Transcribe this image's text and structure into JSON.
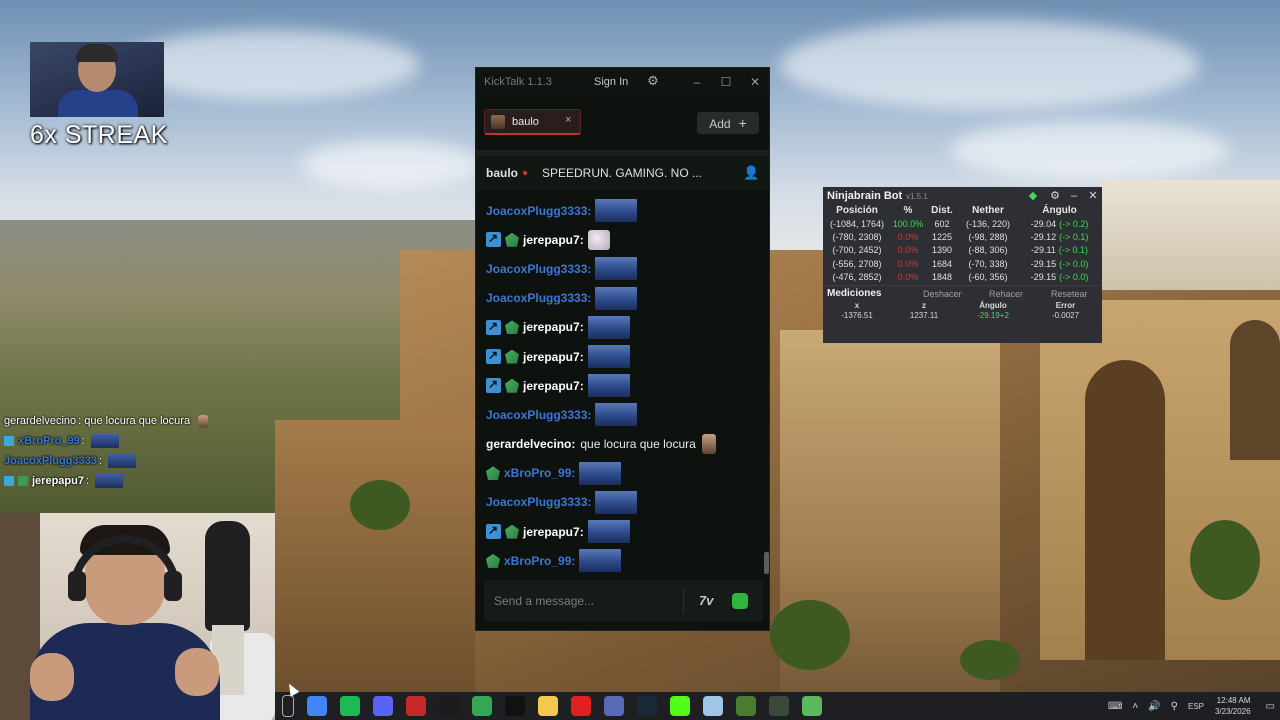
{
  "overlay": {
    "streak_text": "6x STREAK",
    "chat": [
      {
        "user": "gerardelvecino",
        "text": ": que locura que locura",
        "color": "#ffffff",
        "emote": "face"
      },
      {
        "user": "xBroPro_99",
        "text": ":",
        "color": "#3a77d6",
        "emote": "emote"
      },
      {
        "user": "JoacoxPlugg3333",
        "text": ":",
        "color": "#3a77d6",
        "emote": "emote"
      },
      {
        "user": "jerepapu7",
        "text": ":",
        "color": "#ffffff",
        "emote": "emote"
      }
    ]
  },
  "kicktalk": {
    "app_title": "KickTalk 1.1.3",
    "sign_in": "Sign In",
    "icons": {
      "settings": "gear-icon",
      "minimize": "minimize-icon",
      "maximize": "maximize-icon",
      "close": "close-icon"
    },
    "tab": {
      "label": "baulo",
      "close": "×"
    },
    "add_label": "Add",
    "add_plus": "+",
    "channel": {
      "name": "baulo",
      "title": "SPEEDRUN. GAMING. NO ..."
    },
    "username_colors": {
      "blue": "#3a77d6",
      "white": "#ffffff"
    },
    "messages": [
      {
        "user": "JoacoxPlugg3333",
        "sep": ":",
        "color": "#3a77d6",
        "badges": [],
        "emote": "emote"
      },
      {
        "user": "jerepapu7",
        "sep": ":",
        "color": "#ffffff",
        "badges": [
          "mod",
          "sub"
        ],
        "emote": "small"
      },
      {
        "user": "JoacoxPlugg3333",
        "sep": ":",
        "color": "#3a77d6",
        "badges": [],
        "emote": "emote"
      },
      {
        "user": "JoacoxPlugg3333",
        "sep": ":",
        "color": "#3a77d6",
        "badges": [],
        "emote": "emote"
      },
      {
        "user": "jerepapu7",
        "sep": ":",
        "color": "#ffffff",
        "badges": [
          "mod",
          "sub"
        ],
        "emote": "emote"
      },
      {
        "user": "jerepapu7",
        "sep": ":",
        "color": "#ffffff",
        "badges": [
          "mod",
          "sub"
        ],
        "emote": "emote"
      },
      {
        "user": "jerepapu7",
        "sep": ":",
        "color": "#ffffff",
        "badges": [
          "mod",
          "sub"
        ],
        "emote": "emote"
      },
      {
        "user": "JoacoxPlugg3333",
        "sep": ":",
        "color": "#3a77d6",
        "badges": [],
        "emote": "emote"
      },
      {
        "user": "gerardelvecino",
        "sep": ":",
        "color": "#ffffff",
        "badges": [],
        "text": "que locura que locura",
        "emote": "tiny"
      },
      {
        "user": "xBroPro_99",
        "sep": ":",
        "color": "#3a77d6",
        "badges": [
          "sub"
        ],
        "emote": "emote"
      },
      {
        "user": "JoacoxPlugg3333",
        "sep": ":",
        "color": "#3a77d6",
        "badges": [],
        "emote": "emote"
      },
      {
        "user": "jerepapu7",
        "sep": ":",
        "color": "#ffffff",
        "badges": [
          "mod",
          "sub"
        ],
        "emote": "emote"
      },
      {
        "user": "xBroPro_99",
        "sep": ":",
        "color": "#3a77d6",
        "badges": [
          "sub"
        ],
        "emote": "emote"
      }
    ],
    "input_placeholder": "Send a message...",
    "seventv_label": "7v",
    "live_color": "#e02d2d",
    "tab_accent": "#c82f2f"
  },
  "ninjabrain": {
    "title": "Ninjabrain Bot",
    "version": "v1.5.1",
    "icons": [
      "refresh-icon",
      "gear-icon",
      "minimize-icon",
      "close-icon"
    ],
    "headers": [
      "Posición",
      "%",
      "Dist.",
      "Nether",
      "Ángulo"
    ],
    "rows": [
      {
        "pos": "(-1084, 1764)",
        "pct": "100.0%",
        "pct_color": "green",
        "dist": "602",
        "nether": "(-136, 220)",
        "angle": "-29.04",
        "delta": "(-> 0.2)"
      },
      {
        "pos": "(-780, 2308)",
        "pct": "0.0%",
        "pct_color": "red",
        "dist": "1225",
        "nether": "(-98, 288)",
        "angle": "-29.12",
        "delta": "(-> 0.1)"
      },
      {
        "pos": "(-700, 2452)",
        "pct": "0.0%",
        "pct_color": "red",
        "dist": "1390",
        "nether": "(-88, 306)",
        "angle": "-29.11",
        "delta": "(-> 0.1)"
      },
      {
        "pos": "(-556, 2708)",
        "pct": "0.0%",
        "pct_color": "red",
        "dist": "1684",
        "nether": "(-70, 338)",
        "angle": "-29.15",
        "delta": "(-> 0.0)"
      },
      {
        "pos": "(-476, 2852)",
        "pct": "0.0%",
        "pct_color": "red",
        "dist": "1848",
        "nether": "(-60, 356)",
        "angle": "-29.15",
        "delta": "(-> 0.0)"
      }
    ],
    "measurements_title": "Mediciones",
    "undo": "Deshacer",
    "redo": "Rehacer",
    "reset": "Resetear",
    "meas_headers": [
      "x",
      "z",
      "Ángulo",
      "Error"
    ],
    "meas_row": {
      "x": "-1376.51",
      "z": "1237.11",
      "angle": "-29.19+2",
      "error": "-0.0027"
    },
    "green": "#43d94f",
    "red": "#e23232"
  },
  "taskbar": {
    "apps": [
      "start-icon",
      "chrome-icon",
      "spotify-icon",
      "discord-icon",
      "news-icon",
      "obs-icon",
      "chrome-icon",
      "capcut-icon",
      "explorer-icon",
      "opera-icon",
      "game-icon",
      "steam-icon",
      "kick-icon",
      "notes-icon",
      "minecraft-icon",
      "ninjabrain-icon",
      "minecraft-grass-icon"
    ],
    "lang": "ESP",
    "time": "12:48 AM",
    "date": "3/23/2026"
  }
}
